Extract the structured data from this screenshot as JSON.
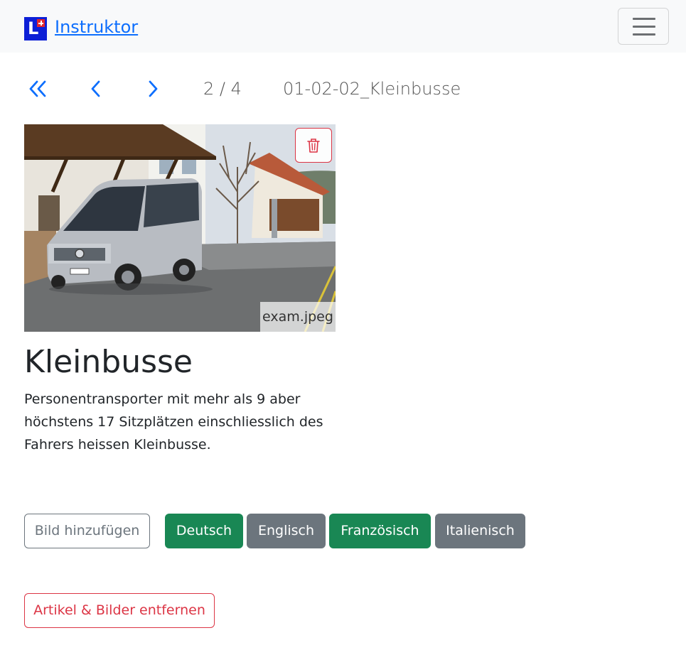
{
  "navbar": {
    "brand_logo_letter": "L",
    "brand_name": "Instruktor",
    "menu_icon": "hamburger-icon"
  },
  "pagination": {
    "first_icon": "double-chevron-left-icon",
    "prev_icon": "chevron-left-icon",
    "next_icon": "chevron-right-icon",
    "counter": "2 / 4",
    "article_code": "01-02-02_Kleinbusse"
  },
  "image": {
    "filename": "exam.jpeg",
    "delete_icon": "trash-icon"
  },
  "article": {
    "title": "Kleinbusse",
    "description": "Personentransporter mit mehr als 9 aber höchstens 17 Sitzplätzen einschliesslich des Fahrers heissen Kleinbusse."
  },
  "actions": {
    "add_image_label": "Bild hinzufügen",
    "languages": [
      {
        "label": "Deutsch",
        "state": "available"
      },
      {
        "label": "Englisch",
        "state": "missing"
      },
      {
        "label": "Französisch",
        "state": "available"
      },
      {
        "label": "Italienisch",
        "state": "missing"
      }
    ],
    "remove_label": "Artikel & Bilder entfernen"
  },
  "colors": {
    "primary": "#0d6efd",
    "success": "#198754",
    "secondary": "#6c757d",
    "danger": "#dc3545"
  }
}
